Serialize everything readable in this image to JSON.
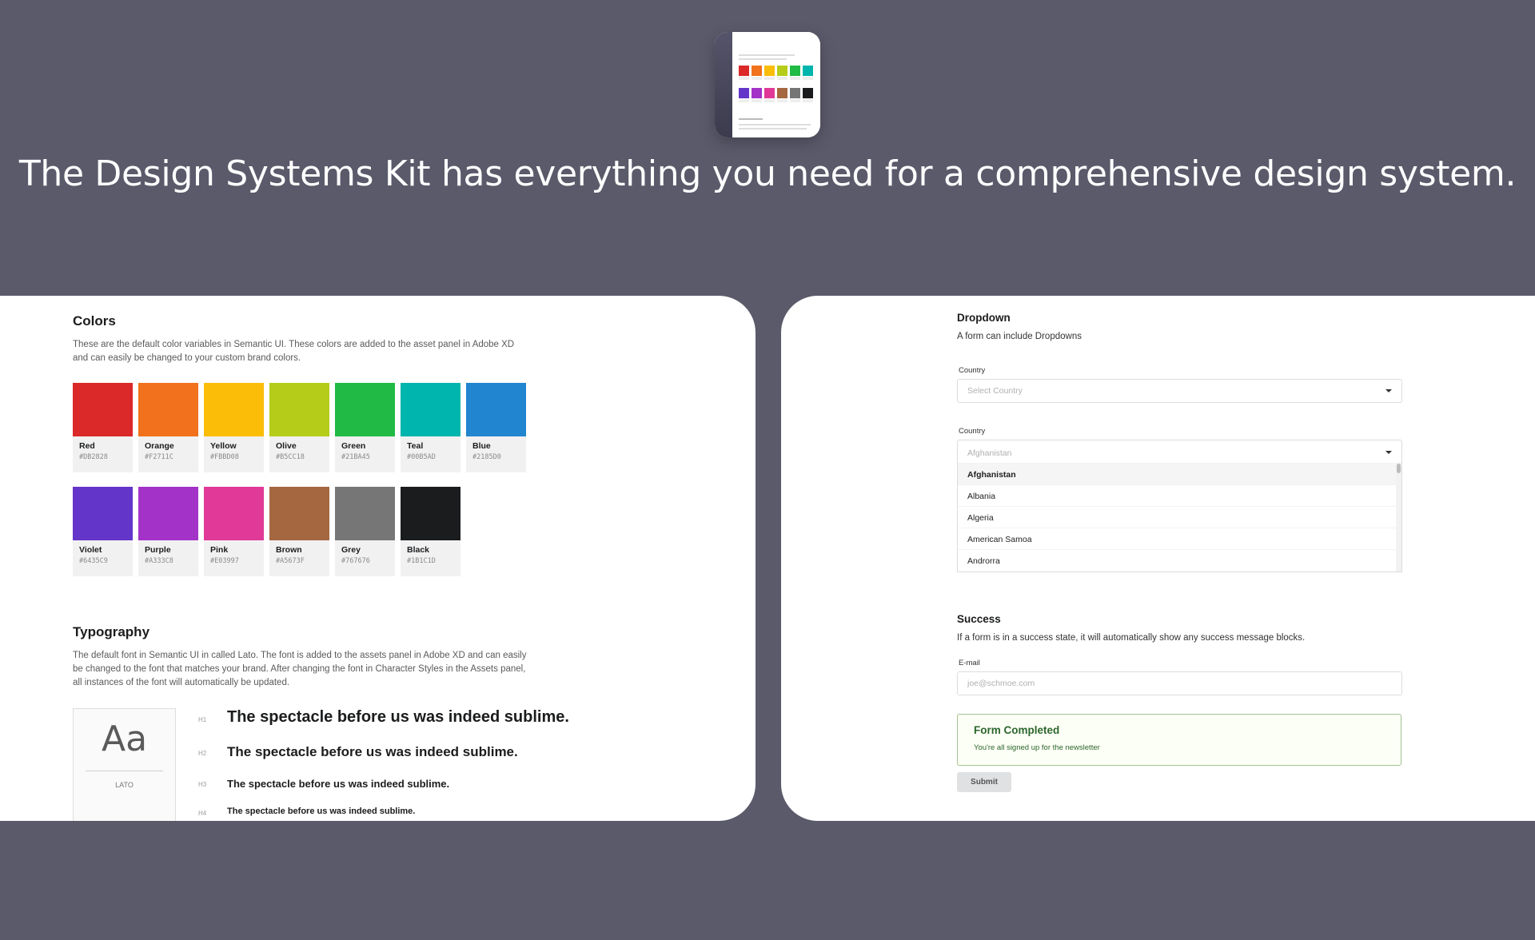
{
  "headline": "The Design Systems Kit has everything you need for a comprehensive design system.",
  "thumbnail": {
    "icon": "design-kit-preview-image"
  },
  "colors_section": {
    "title": "Colors",
    "description_line1": "These are the default color variables in Semantic UI. These colors are added to the asset panel in Adobe XD",
    "description_line2": "and can easily be changed to your custom brand colors.",
    "swatches": [
      {
        "name": "Red",
        "hex": "#DB2828",
        "color": "#db2828"
      },
      {
        "name": "Orange",
        "hex": "#F2711C",
        "color": "#f2711c"
      },
      {
        "name": "Yellow",
        "hex": "#FBBD08",
        "color": "#fbbd08"
      },
      {
        "name": "Olive",
        "hex": "#B5CC18",
        "color": "#b5cc18"
      },
      {
        "name": "Green",
        "hex": "#21BA45",
        "color": "#21ba45"
      },
      {
        "name": "Teal",
        "hex": "#00B5AD",
        "color": "#00b5ad"
      },
      {
        "name": "Blue",
        "hex": "#2185D0",
        "color": "#2185d0"
      },
      {
        "name": "Violet",
        "hex": "#6435C9",
        "color": "#6435c9"
      },
      {
        "name": "Purple",
        "hex": "#A333C8",
        "color": "#a333c8"
      },
      {
        "name": "Pink",
        "hex": "#E03997",
        "color": "#e03997"
      },
      {
        "name": "Brown",
        "hex": "#A5673F",
        "color": "#a5673f"
      },
      {
        "name": "Grey",
        "hex": "#767676",
        "color": "#767676"
      },
      {
        "name": "Black",
        "hex": "#1B1C1D",
        "color": "#1b1c1d"
      }
    ]
  },
  "typography_section": {
    "title": "Typography",
    "description_line1": "The default font in Semantic UI in called Lato. The font is added to the assets panel in Adobe XD and can easily",
    "description_line2": "be changed to the font that matches your brand. After changing the font in Character Styles in the Assets panel,",
    "description_line3": "all instances of the font will automatically be updated.",
    "specimen": "Aa",
    "font_name": "LATO",
    "headings": [
      {
        "level": "H1",
        "text": "The spectacle before us was indeed sublime."
      },
      {
        "level": "H2",
        "text": "The spectacle before us was indeed sublime."
      },
      {
        "level": "H3",
        "text": "The spectacle before us was indeed sublime."
      },
      {
        "level": "H4",
        "text": "The spectacle before us was indeed sublime."
      }
    ]
  },
  "dropdown_section": {
    "title": "Dropdown",
    "description": "A form can include Dropdowns",
    "field1": {
      "label": "Country",
      "placeholder": "Select Country"
    },
    "field2": {
      "label": "Country",
      "value": "Afghanistan",
      "options": [
        "Afghanistan",
        "Albania",
        "Algeria",
        "American Samoa",
        "Androrra"
      ]
    }
  },
  "success_section": {
    "title": "Success",
    "description": "If a form is in a success state, it will automatically show any success message blocks.",
    "email_label": "E-mail",
    "email_placeholder": "joe@schmoe.com",
    "message_title": "Form Completed",
    "message_body": "You're all signed up for the newsletter",
    "submit_label": "Submit"
  }
}
